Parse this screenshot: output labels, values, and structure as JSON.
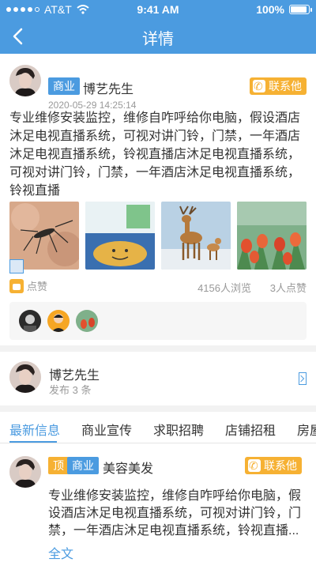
{
  "status_bar": {
    "carrier": "AT&T",
    "time": "9:41 AM",
    "battery": "100%"
  },
  "header": {
    "title": "详情"
  },
  "post": {
    "tag": "商业",
    "name": "博艺先生",
    "time": "2020-05-29  14:25:14",
    "contact_label": "联系他",
    "body": "专业维修安装监控，维修自咋呼给你电脑，假设酒店沐足电视直播系统，可视对讲门铃，门禁，一年酒店沐足电视直播系统，铃视直播店沐足电视直播系统，可视对讲门铃，门禁，一年酒店沐足电视直播系统，铃视直播",
    "like_label": "点赞",
    "views": "4156人浏览",
    "likes": "3人点赞"
  },
  "author": {
    "name": "博艺先生",
    "count": "发布 3 条"
  },
  "tabs": [
    {
      "label": "最新信息"
    },
    {
      "label": "商业宣传"
    },
    {
      "label": "求职招聘"
    },
    {
      "label": "店铺招租"
    },
    {
      "label": "房屋"
    }
  ],
  "item": {
    "tag_top": "顶",
    "tag": "商业",
    "name": "美容美发",
    "contact_label": "联系他",
    "body": "专业维修安装监控，维修自咋呼给你电脑，假设酒店沐足电视直播系统，可视对讲门铃，门禁，一年酒店沐足电视直播系统，铃视直播...",
    "more": "全文"
  },
  "colors": {
    "primary": "#4b9be0",
    "accent": "#f6b133"
  }
}
